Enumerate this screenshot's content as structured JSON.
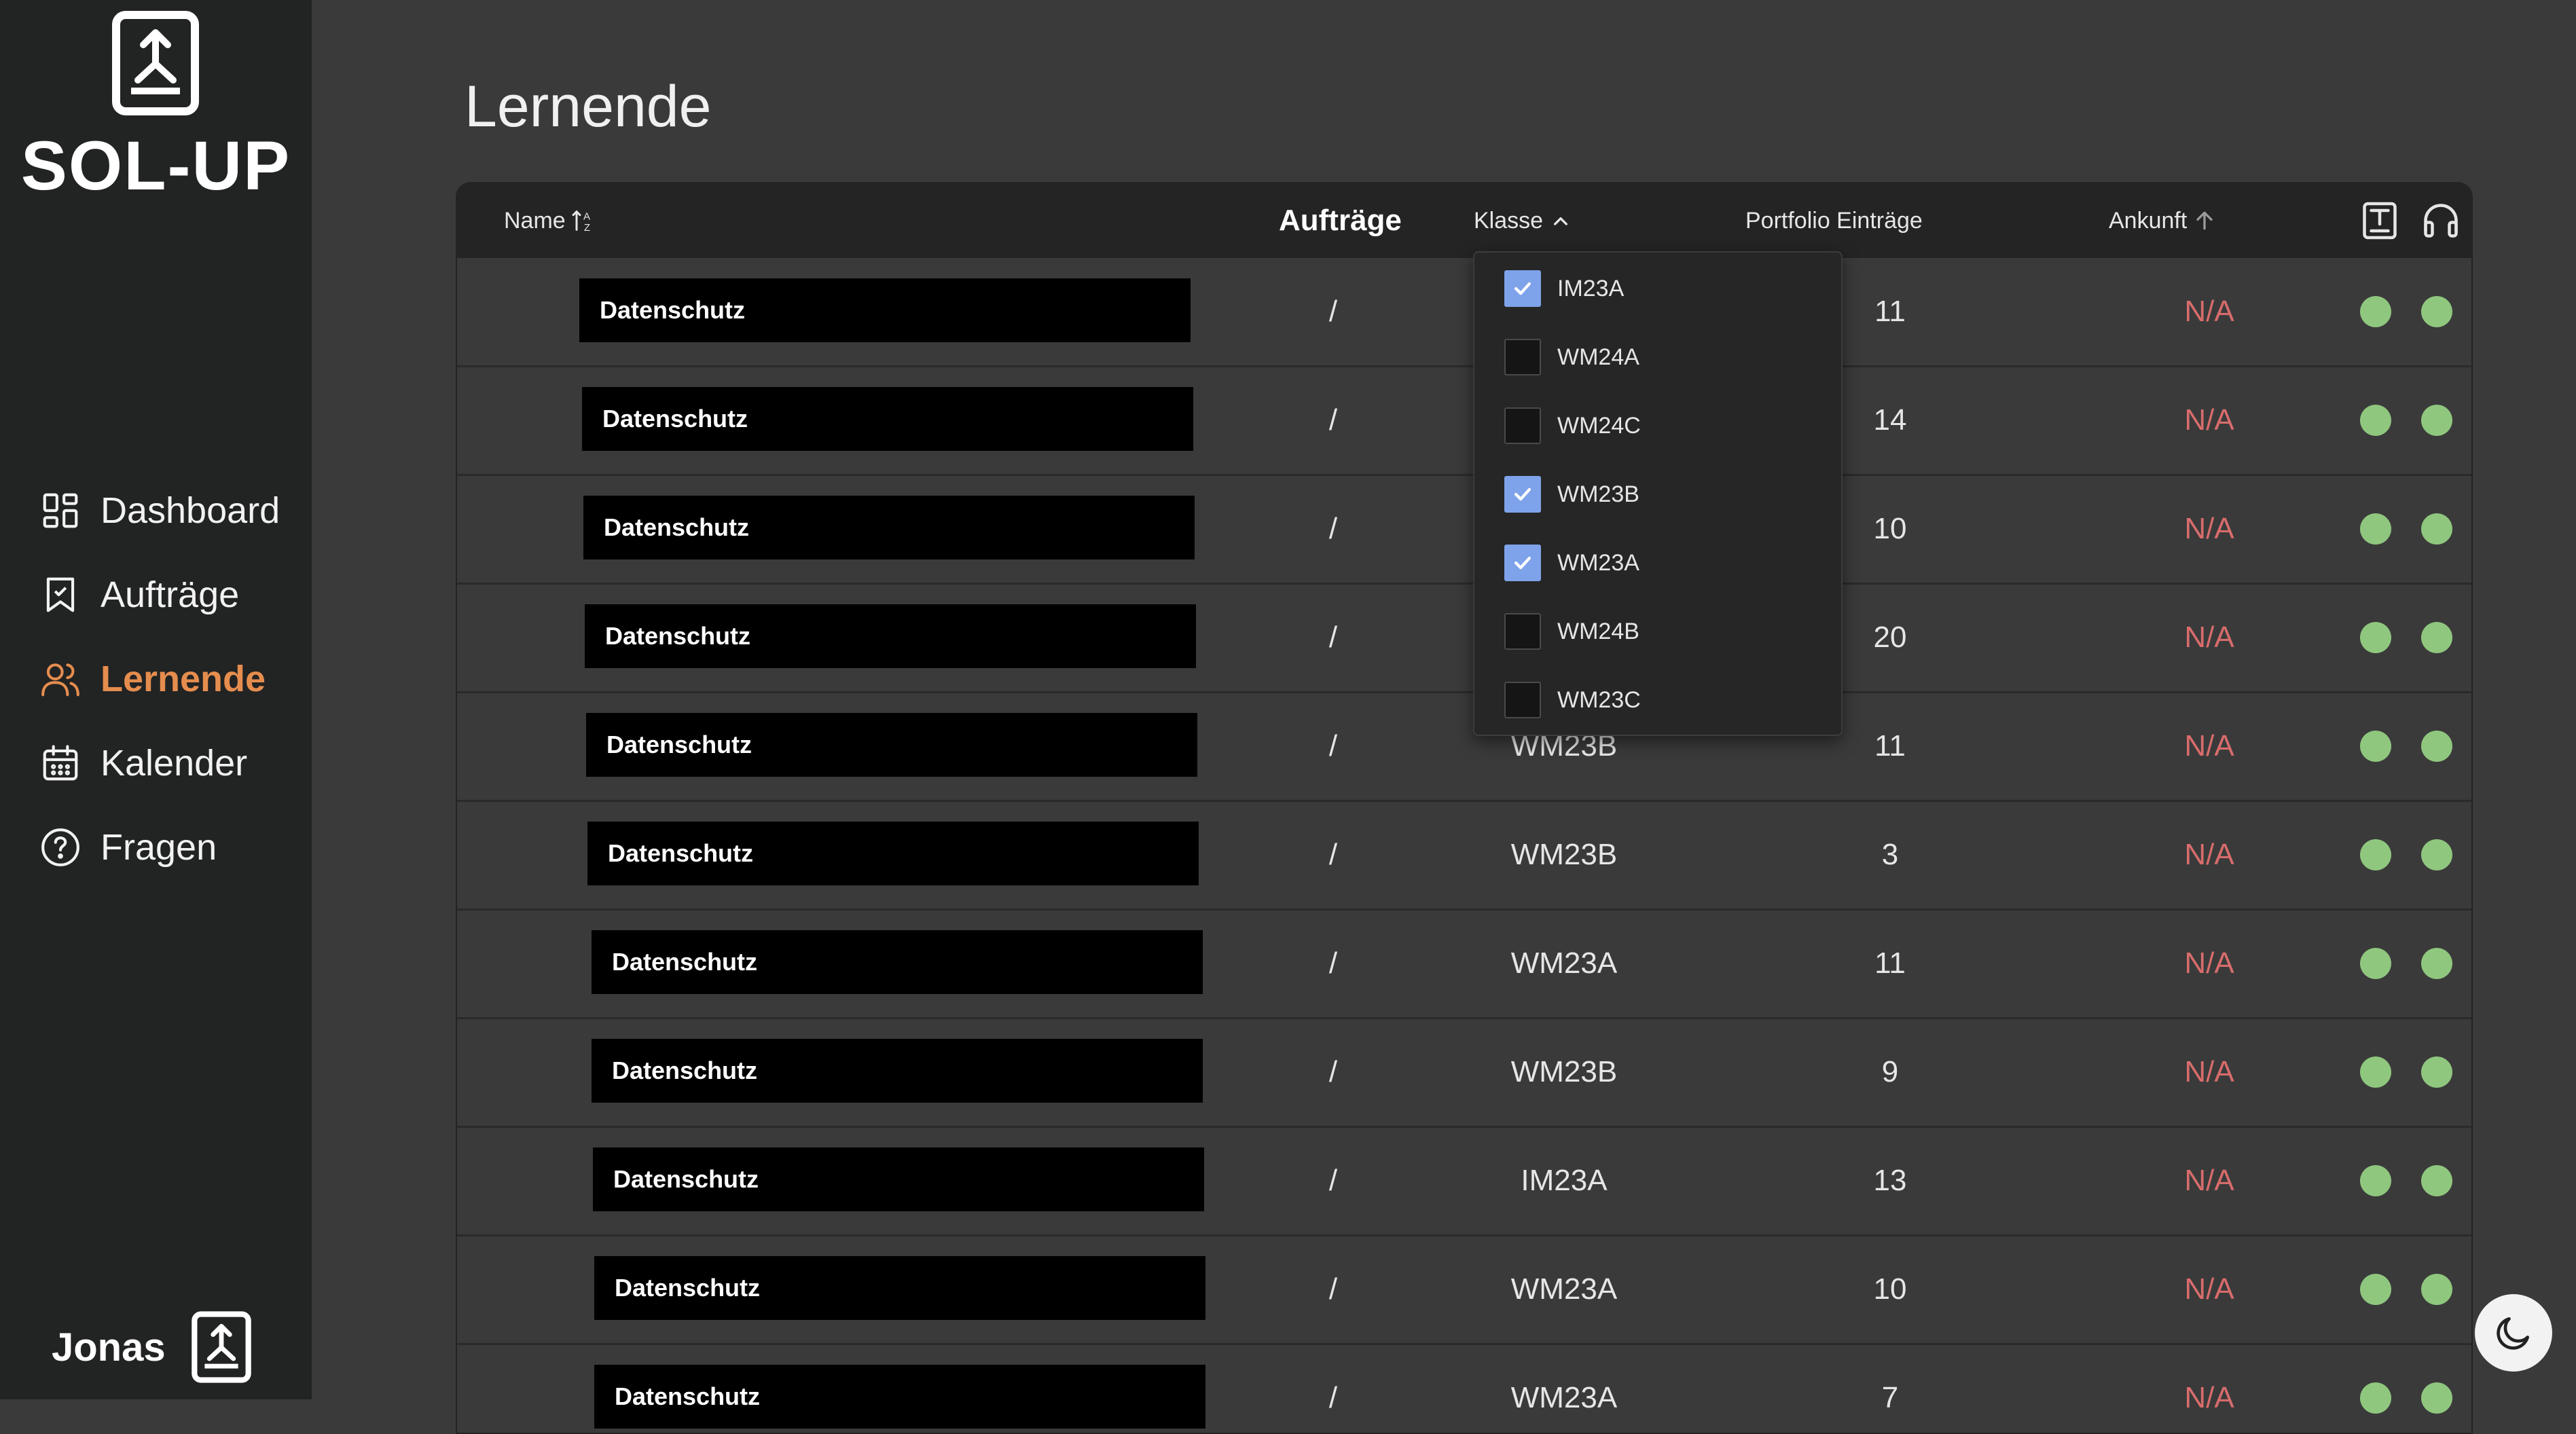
{
  "app": {
    "brand": "SOL-UP"
  },
  "page": {
    "title": "Lernende"
  },
  "sidebar": {
    "items": [
      {
        "label": "Dashboard",
        "icon": "dashboard-icon",
        "active": false
      },
      {
        "label": "Aufträge",
        "icon": "bookmark-icon",
        "active": false
      },
      {
        "label": "Lernende",
        "icon": "users-icon",
        "active": true
      },
      {
        "label": "Kalender",
        "icon": "calendar-icon",
        "active": false
      },
      {
        "label": "Fragen",
        "icon": "help-icon",
        "active": false
      }
    ],
    "user": {
      "name": "Jonas",
      "avatar_icon": "logo-icon"
    }
  },
  "table": {
    "headers": {
      "name": "Name",
      "auftraege": "Aufträge",
      "klasse": "Klasse",
      "portfolio": "Portfolio Einträge",
      "ankunft": "Ankunft"
    },
    "rows": [
      {
        "name": "Datenschutz",
        "auftraege": "/",
        "klasse": "",
        "portfolio": "11",
        "ankunft": "N/A"
      },
      {
        "name": "Datenschutz",
        "auftraege": "/",
        "klasse": "",
        "portfolio": "14",
        "ankunft": "N/A"
      },
      {
        "name": "Datenschutz",
        "auftraege": "/",
        "klasse": "",
        "portfolio": "10",
        "ankunft": "N/A"
      },
      {
        "name": "Datenschutz",
        "auftraege": "/",
        "klasse": "",
        "portfolio": "20",
        "ankunft": "N/A"
      },
      {
        "name": "Datenschutz",
        "auftraege": "/",
        "klasse": "WM23B",
        "portfolio": "11",
        "ankunft": "N/A"
      },
      {
        "name": "Datenschutz",
        "auftraege": "/",
        "klasse": "WM23B",
        "portfolio": "3",
        "ankunft": "N/A"
      },
      {
        "name": "Datenschutz",
        "auftraege": "/",
        "klasse": "WM23A",
        "portfolio": "11",
        "ankunft": "N/A"
      },
      {
        "name": "Datenschutz",
        "auftraege": "/",
        "klasse": "WM23B",
        "portfolio": "9",
        "ankunft": "N/A"
      },
      {
        "name": "Datenschutz",
        "auftraege": "/",
        "klasse": "IM23A",
        "portfolio": "13",
        "ankunft": "N/A"
      },
      {
        "name": "Datenschutz",
        "auftraege": "/",
        "klasse": "WM23A",
        "portfolio": "10",
        "ankunft": "N/A"
      },
      {
        "name": "Datenschutz",
        "auftraege": "/",
        "klasse": "WM23A",
        "portfolio": "7",
        "ankunft": "N/A"
      }
    ]
  },
  "class_filter": {
    "options": [
      {
        "label": "IM23A",
        "checked": true
      },
      {
        "label": "WM24A",
        "checked": false
      },
      {
        "label": "WM24C",
        "checked": false
      },
      {
        "label": "WM23B",
        "checked": true
      },
      {
        "label": "WM23A",
        "checked": true
      },
      {
        "label": "WM24B",
        "checked": false
      },
      {
        "label": "WM23C",
        "checked": false
      }
    ]
  },
  "colors": {
    "accent": "#e58d4e",
    "status_ok": "#8fc77e",
    "na_text": "#d86c6c",
    "checkbox_checked": "#7ea3ea"
  }
}
